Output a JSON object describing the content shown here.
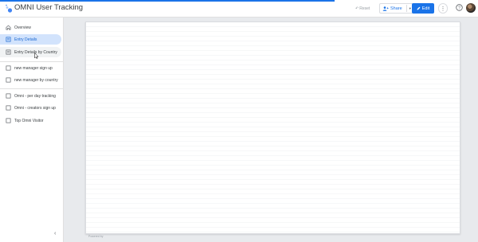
{
  "app": {
    "title": "OMNI User Tracking",
    "accent_color": "#1a73e8"
  },
  "toolbar": {
    "reset_label": "Reset",
    "reset_icon": "undo-icon",
    "share_label": "Share",
    "share_icon": "add-person-icon",
    "edit_label": "Edit",
    "edit_icon": "pencil-icon"
  },
  "sidebar": {
    "items": [
      {
        "label": "Overview",
        "icon": "home-icon",
        "state": "normal"
      },
      {
        "label": "Entry Details",
        "icon": "page-icon",
        "state": "active"
      },
      {
        "label": "Entry Details by Country",
        "icon": "page-icon",
        "state": "hover"
      },
      {
        "label": "new manager sign up",
        "icon": "page-icon",
        "state": "normal"
      },
      {
        "label": "new manager by country",
        "icon": "page-icon",
        "state": "normal"
      },
      {
        "label": "Omni - per day tracking",
        "icon": "page-icon",
        "state": "normal"
      },
      {
        "label": "Omni - creators sign up",
        "icon": "page-icon",
        "state": "normal"
      },
      {
        "label": "Top Omni Visitor",
        "icon": "page-icon",
        "state": "normal"
      }
    ]
  },
  "canvas": {
    "footer_text": "Powered by"
  }
}
